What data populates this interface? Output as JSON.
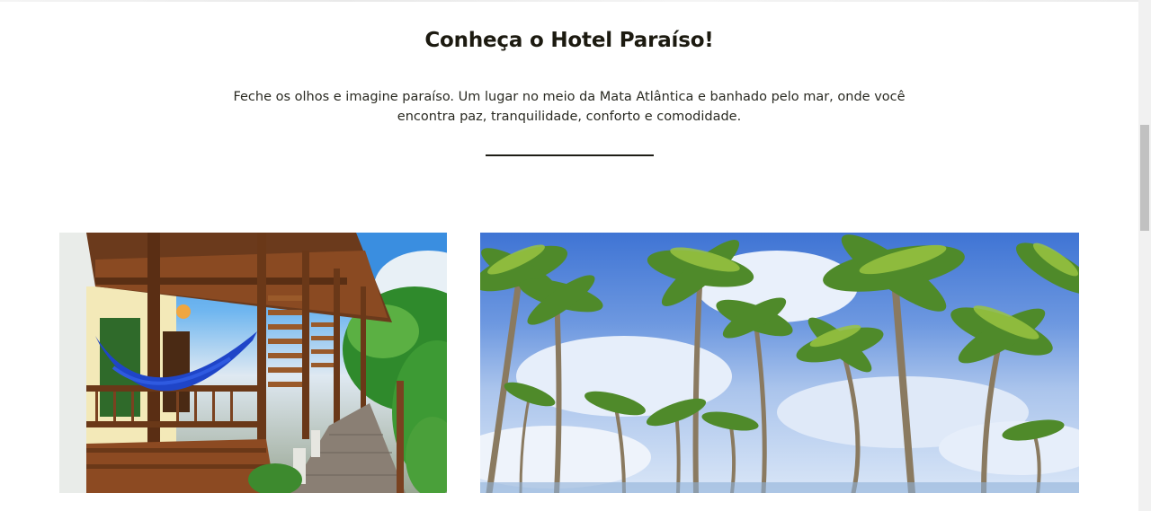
{
  "section": {
    "title": "Conheça o Hotel Paraíso!",
    "description": "Feche os olhos e imagine paraíso. Um lugar no meio da Mata Atlântica e banhado pelo mar, onde você encontra paz, tranquilidade, conforto e comodidade."
  },
  "gallery": {
    "images": [
      {
        "subject": "hotel-veranda-with-hammocks"
      },
      {
        "subject": "coconut-palm-trees-blue-sky"
      }
    ]
  },
  "colors": {
    "title": "#1c1a10",
    "text": "#2a2a22",
    "divider": "#1e1d16",
    "background": "#ffffff"
  }
}
